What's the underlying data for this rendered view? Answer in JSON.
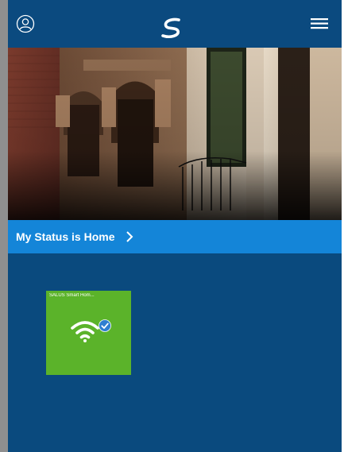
{
  "header": {
    "profile_icon": "user-circle-icon",
    "logo_icon": "salus-logo-icon",
    "menu_icon": "hamburger-menu-icon"
  },
  "hero": {
    "image": "brownstone-building-photo"
  },
  "status": {
    "label": "My Status is Home",
    "chevron_icon": "chevron-right-icon"
  },
  "devices": [
    {
      "name": "SALUS Smart Hom...",
      "icon": "wifi-icon",
      "status_icon": "check-circle-icon",
      "tile_color": "#5bb32a"
    }
  ],
  "colors": {
    "header": "#0b4a7f",
    "background": "#0a4a7e",
    "status_bar": "#1485d8",
    "badge": "#2f7fd0"
  }
}
